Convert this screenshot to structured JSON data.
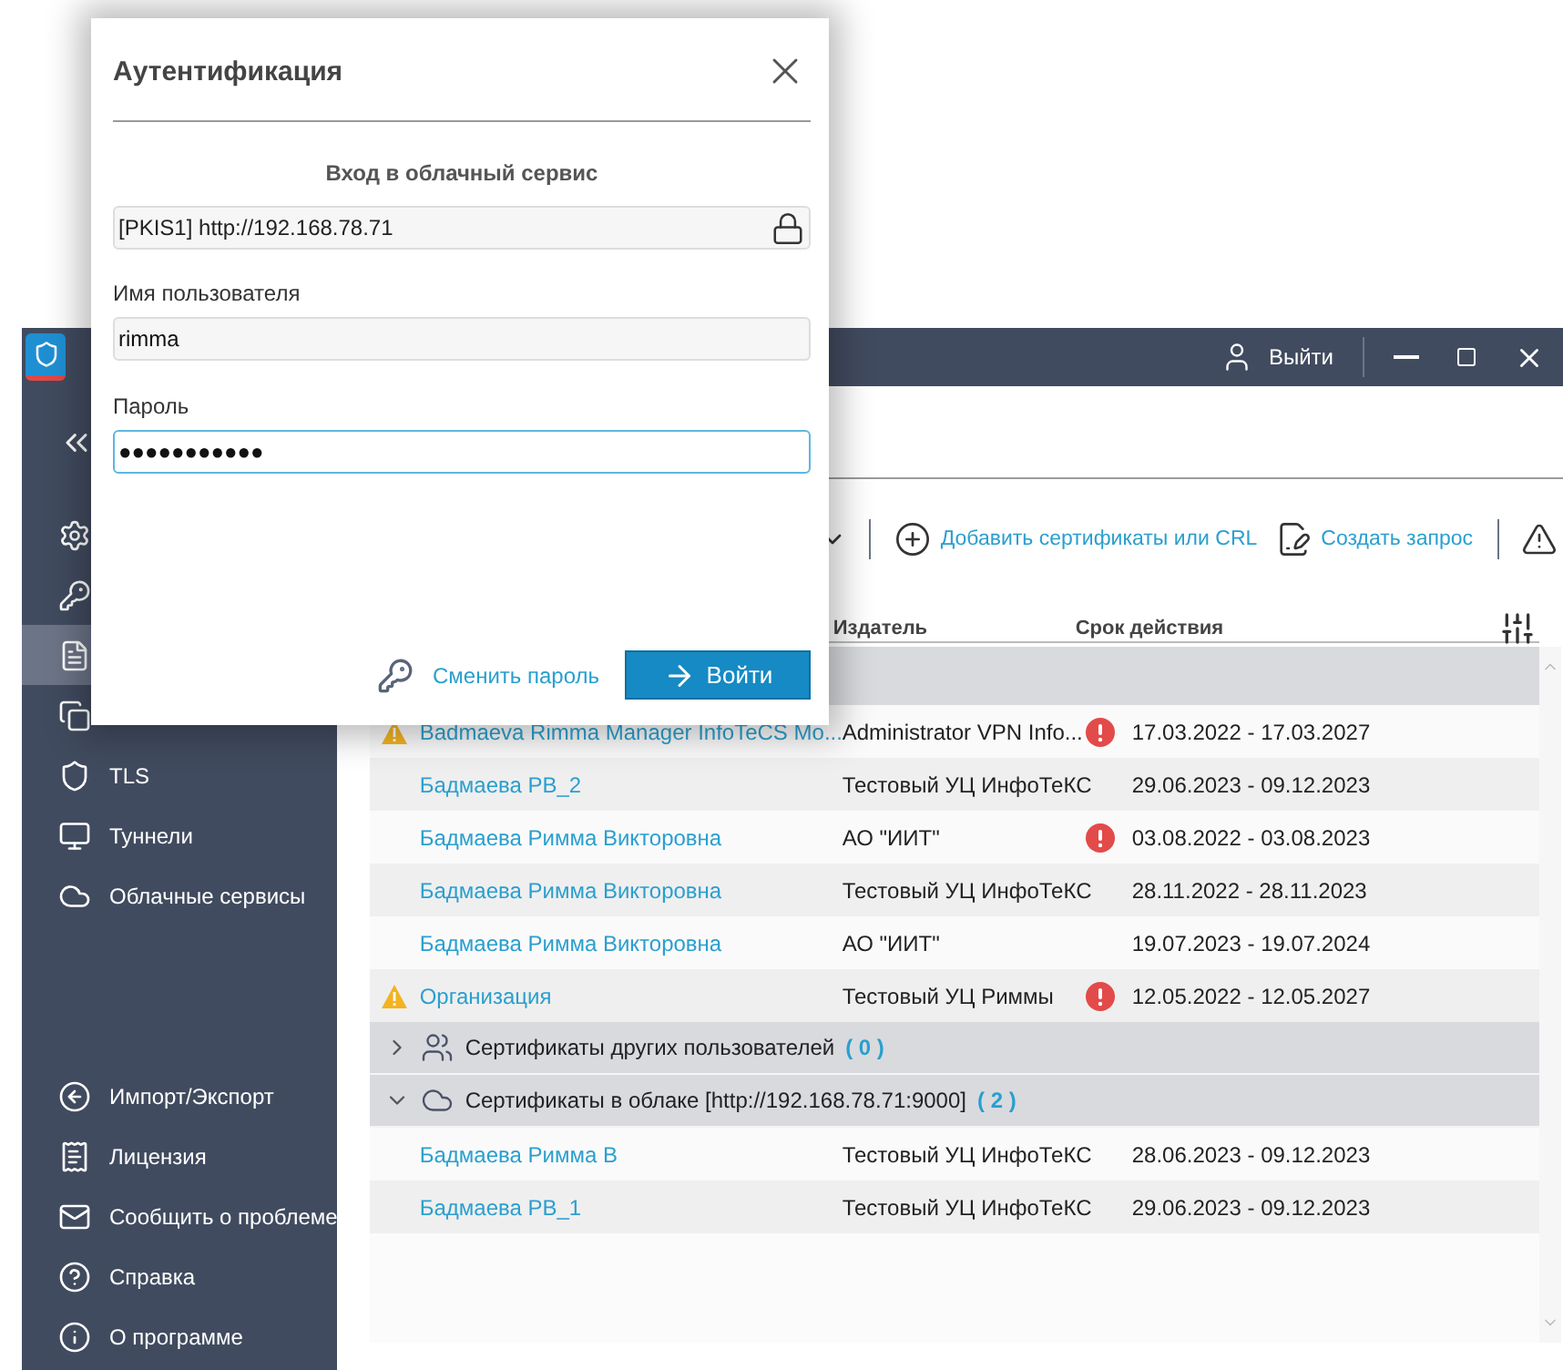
{
  "app": {
    "logout": "Выйти"
  },
  "sidebar": {
    "top_items": [
      {
        "kind": "collapse",
        "selected": false
      },
      {
        "kind": "gear",
        "selected": false
      },
      {
        "kind": "keys",
        "selected": false
      },
      {
        "kind": "document",
        "selected": true
      },
      {
        "kind": "copies",
        "selected": false
      },
      {
        "kind": "shield",
        "label": "TLS",
        "selected": false
      },
      {
        "kind": "monitor",
        "label": "Туннели",
        "selected": false
      },
      {
        "kind": "cloud",
        "label": "Облачные сервисы",
        "selected": false
      }
    ],
    "bottom_items": [
      {
        "kind": "import",
        "label": "Импорт/Экспорт"
      },
      {
        "kind": "license",
        "label": "Лицензия"
      },
      {
        "kind": "mail",
        "label": "Сообщить о проблеме"
      },
      {
        "kind": "help",
        "label": "Справка"
      },
      {
        "kind": "info",
        "label": "О программе"
      }
    ]
  },
  "toolbar": {
    "actions": [
      {
        "kind": "add",
        "label": "Добавить сертификаты или CRL"
      },
      {
        "kind": "request",
        "label": "Создать запрос"
      }
    ]
  },
  "table": {
    "columns": [
      "Издатель",
      "Срок действия"
    ],
    "rows": [
      {
        "kind": "cert",
        "name": "Badmaeva Rimma Manager InfoTeCS Mo...",
        "issuer": "Administrator VPN Info...",
        "validity": "17.03.2022 - 17.03.2027",
        "warning": true,
        "error": true
      },
      {
        "kind": "cert",
        "name": "Бадмаева РВ_2",
        "issuer": "Тестовый УЦ ИнфоТеКС",
        "validity": "29.06.2023 - 09.12.2023",
        "warning": false,
        "error": false
      },
      {
        "kind": "cert",
        "name": "Бадмаева Римма Викторовна",
        "issuer": "АО \"ИИТ\"",
        "validity": "03.08.2022 - 03.08.2023",
        "warning": false,
        "error": true
      },
      {
        "kind": "cert",
        "name": "Бадмаева Римма Викторовна",
        "issuer": "Тестовый УЦ ИнфоТеКС",
        "validity": "28.11.2022 - 28.11.2023",
        "warning": false,
        "error": false
      },
      {
        "kind": "cert",
        "name": "Бадмаева Римма Викторовна",
        "issuer": "АО \"ИИТ\"",
        "validity": "19.07.2023 - 19.07.2024",
        "warning": false,
        "error": false
      },
      {
        "kind": "cert",
        "name": "Организация",
        "issuer": "Тестовый УЦ Риммы",
        "validity": "12.05.2022 - 12.05.2027",
        "warning": true,
        "error": true
      },
      {
        "kind": "users_group",
        "label": "Сертификаты других пользователей",
        "count": "( 0 )",
        "expanded": false
      },
      {
        "kind": "cloud_group",
        "label": "Сертификаты в облаке [http://192.168.78.71:9000]",
        "count": "( 2 )",
        "expanded": true
      },
      {
        "kind": "cert",
        "name": "Бадмаева  Римма В",
        "issuer": "Тестовый УЦ ИнфоТеКС",
        "validity": "28.06.2023 - 09.12.2023",
        "warning": false,
        "error": false
      },
      {
        "kind": "cert",
        "name": "Бадмаева РВ_1",
        "issuer": "Тестовый УЦ ИнфоТеКС",
        "validity": "29.06.2023 - 09.12.2023",
        "warning": false,
        "error": false
      }
    ]
  },
  "dialog": {
    "title": "Аутентификация",
    "subtitle": "Вход в облачный сервис",
    "server": {
      "value": "[PKIS1] http://192.168.78.71",
      "locked": true
    },
    "fields": [
      {
        "label": "Имя пользователя",
        "value": "rimma",
        "focused": false
      },
      {
        "label": "Пароль",
        "value": "●●●●●●●●●●●",
        "focused": true
      }
    ],
    "change_password": "Сменить пароль",
    "login_button": "Войти"
  }
}
